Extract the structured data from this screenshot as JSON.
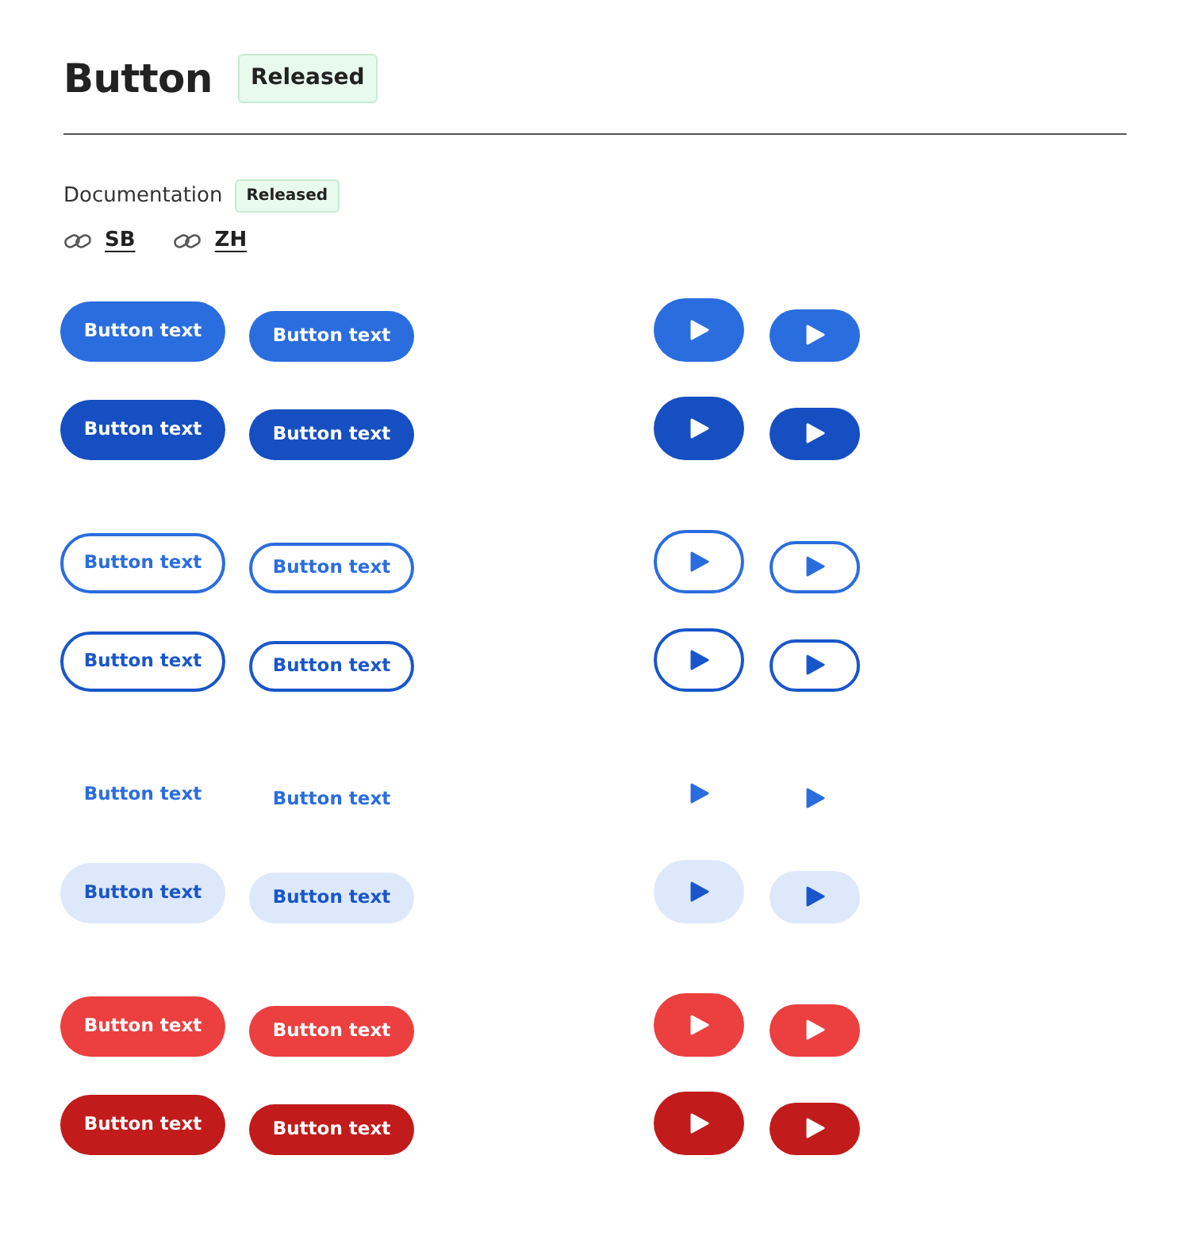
{
  "header": {
    "title": "Button",
    "status": "Released"
  },
  "documentation": {
    "label": "Documentation",
    "status": "Released",
    "links": [
      {
        "label": "SB"
      },
      {
        "label": "ZH"
      }
    ]
  },
  "groups": [
    {
      "rows": [
        {
          "kind": "primary",
          "hover": false,
          "large_label": "Button text",
          "small_label": "Button text"
        },
        {
          "kind": "primary",
          "hover": true,
          "large_label": "Button text",
          "small_label": "Button text"
        }
      ]
    },
    {
      "rows": [
        {
          "kind": "outline",
          "hover": false,
          "large_label": "Button text",
          "small_label": "Button text"
        },
        {
          "kind": "outline",
          "hover": true,
          "large_label": "Button text",
          "small_label": "Button text"
        }
      ]
    },
    {
      "rows": [
        {
          "kind": "ghost",
          "large_label": "Button text",
          "small_label": "Button text"
        },
        {
          "kind": "tonal",
          "large_label": "Button text",
          "small_label": "Button text"
        }
      ]
    },
    {
      "rows": [
        {
          "kind": "danger",
          "hover": false,
          "large_label": "Button text",
          "small_label": "Button text"
        },
        {
          "kind": "danger",
          "hover": true,
          "large_label": "Button text",
          "small_label": "Button text"
        }
      ]
    }
  ]
}
